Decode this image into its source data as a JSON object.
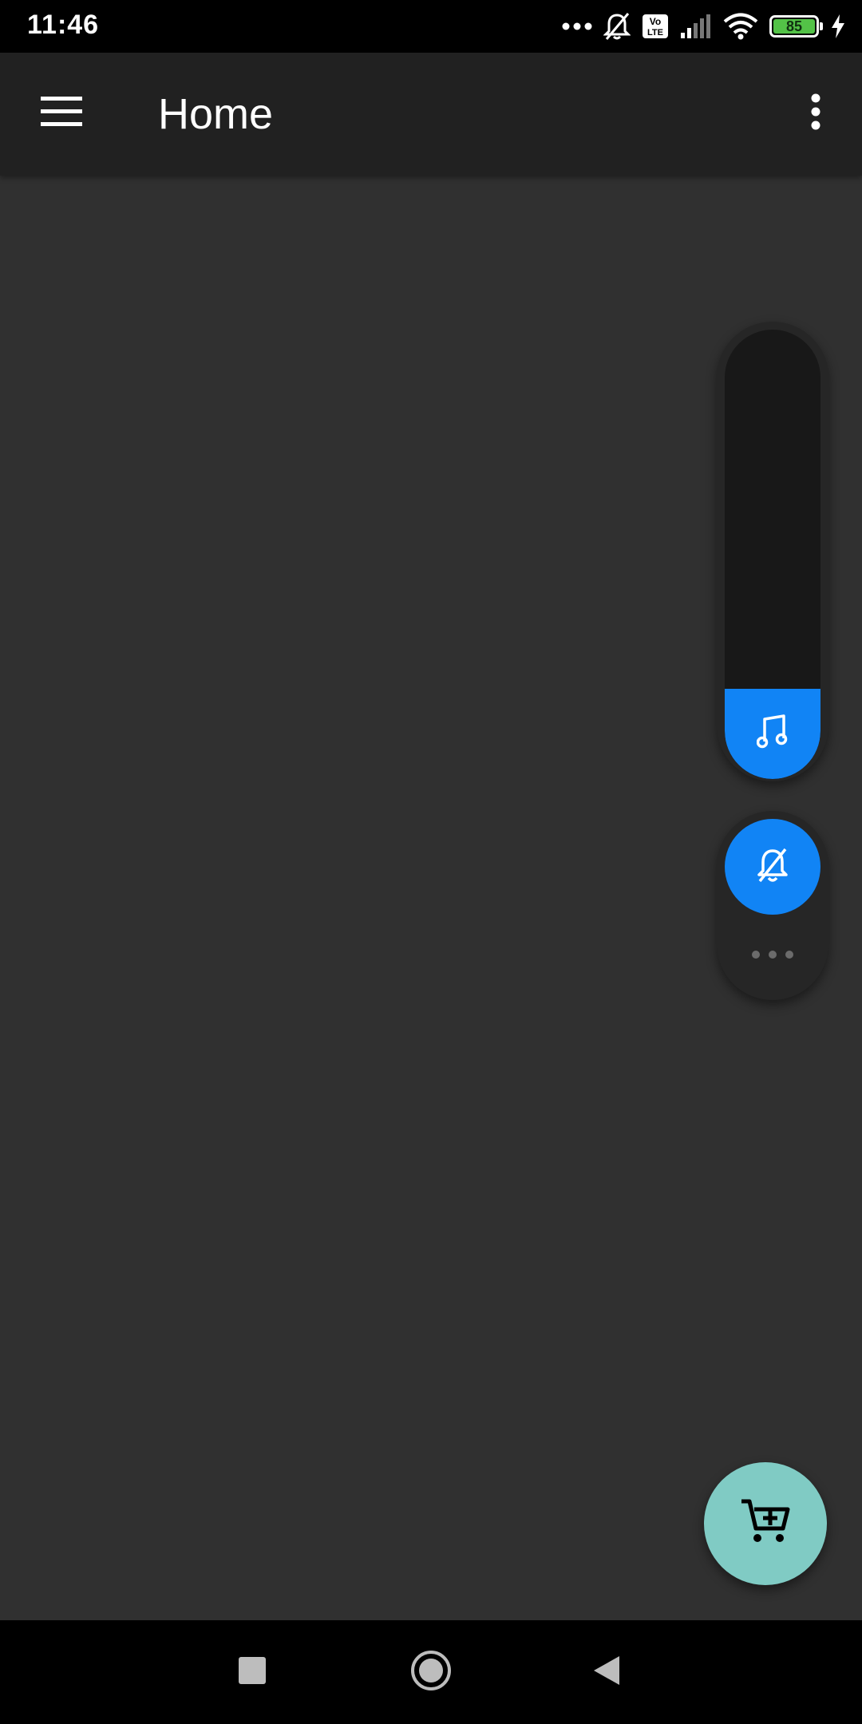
{
  "status_bar": {
    "time": "11:46",
    "battery_level": "85",
    "icons": [
      "more-dots-icon",
      "bell-off-icon",
      "volte-icon",
      "signal-icon",
      "wifi-icon",
      "battery-icon",
      "charging-icon"
    ],
    "volte_label_top": "Vo",
    "volte_label_bottom": "LTE"
  },
  "app_bar": {
    "title": "Home",
    "menu_icon": "hamburger-menu-icon",
    "overflow_icon": "more-vert-icon"
  },
  "volume_panel": {
    "stream_icon": "music-note-icon",
    "level_fraction": 0.2,
    "accent_color": "#1184f5"
  },
  "ringer_panel": {
    "ringer_icon": "bell-off-icon",
    "more_icon": "more-horiz-icon"
  },
  "fab": {
    "icon": "add-shopping-cart-icon",
    "color": "#80cbc4"
  },
  "nav_bar": {
    "buttons": [
      "recents-square-icon",
      "home-circle-icon",
      "back-triangle-icon"
    ]
  }
}
